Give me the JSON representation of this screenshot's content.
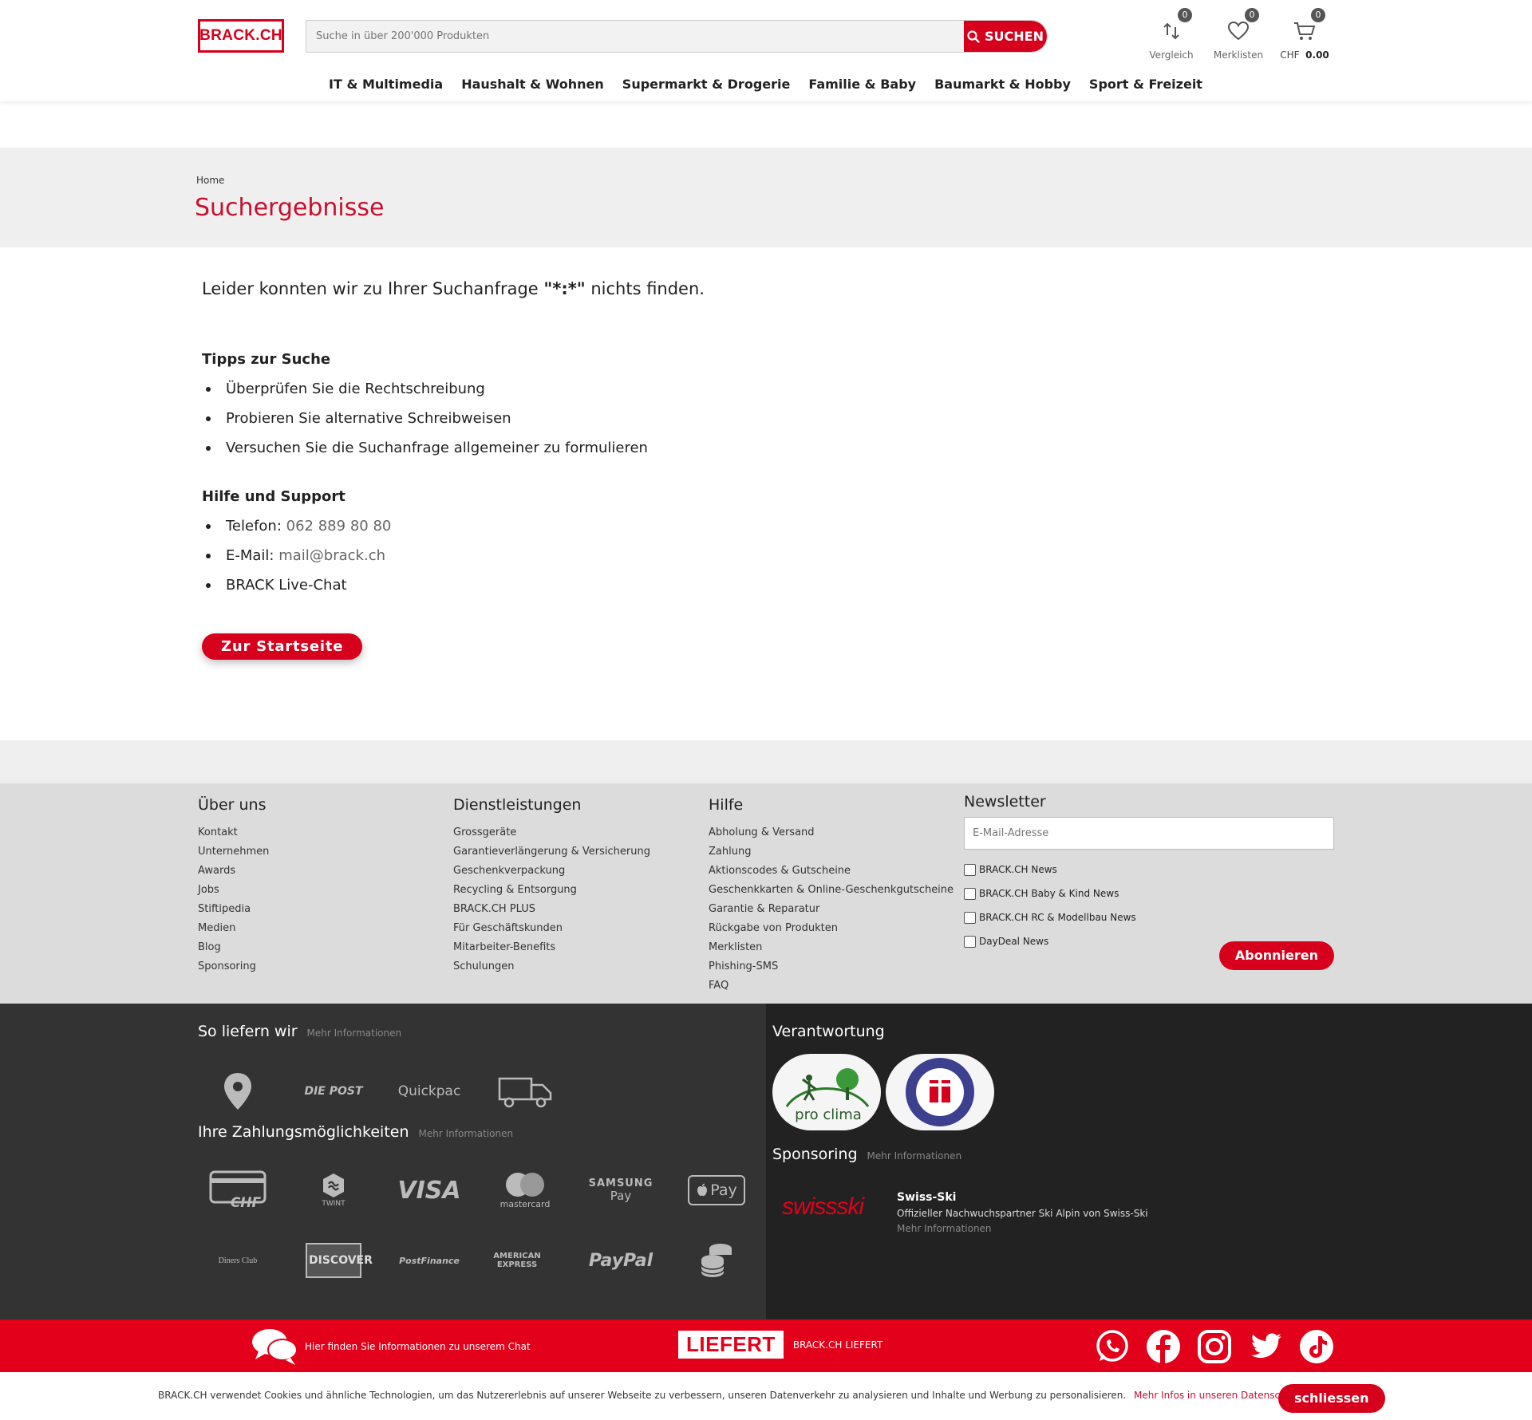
{
  "header": {
    "logo": "BRACK.CH",
    "search_placeholder": "Suche in über 200'000 Produkten",
    "search_button": "SUCHEN",
    "compare": {
      "label": "Vergleich",
      "count": "0"
    },
    "wishlist": {
      "label": "Merklisten",
      "count": "0"
    },
    "cart": {
      "currency": "CHF",
      "amount": "0.00",
      "count": "0"
    },
    "nav": [
      "IT & Multimedia",
      "Haushalt & Wohnen",
      "Supermarkt & Drogerie",
      "Familie & Baby",
      "Baumarkt & Hobby",
      "Sport & Freizeit"
    ]
  },
  "page": {
    "breadcrumb": "Home",
    "title": "Suchergebnisse",
    "no_results_prefix": "Leider konnten wir zu Ihrer Suchanfrage",
    "query": "\"*:*\"",
    "no_results_suffix": "nichts finden.",
    "tips_title": "Tipps zur Suche",
    "tips": [
      "Überprüfen Sie die Rechtschreibung",
      "Probieren Sie alternative Schreibweisen",
      "Versuchen Sie die Suchanfrage allgemeiner zu formulieren"
    ],
    "help_title": "Hilfe und Support",
    "phone_label": "Telefon:",
    "phone": "062 889 80 80",
    "email_label": "E-Mail:",
    "email": "mail@brack.ch",
    "livechat": "BRACK Live-Chat",
    "home_button": "Zur Startseite"
  },
  "footer": {
    "about": {
      "title": "Über uns",
      "links": [
        "Kontakt",
        "Unternehmen",
        "Awards",
        "Jobs",
        "Stiftipedia",
        "Medien",
        "Blog",
        "Sponsoring"
      ]
    },
    "services": {
      "title": "Dienstleistungen",
      "links": [
        "Grossgeräte",
        "Garantieverlängerung & Versicherung",
        "Geschenkverpackung",
        "Recycling & Entsorgung",
        "BRACK.CH PLUS",
        "Für Geschäftskunden",
        "Mitarbeiter-Benefits",
        "Schulungen"
      ]
    },
    "help": {
      "title": "Hilfe",
      "links": [
        "Abholung & Versand",
        "Zahlung",
        "Aktionscodes & Gutscheine",
        "Geschenkkarten & Online-Geschenkgutscheine",
        "Garantie & Reparatur",
        "Rückgabe von Produkten",
        "Merklisten",
        "Phishing-SMS",
        "FAQ"
      ]
    },
    "newsletter": {
      "title": "Newsletter",
      "email_placeholder": "E-Mail-Adresse",
      "options": [
        "BRACK.CH News",
        "BRACK.CH Baby & Kind News",
        "BRACK.CH RC & Modellbau News",
        "DayDeal News"
      ],
      "subscribe": "Abonnieren"
    },
    "delivery": {
      "title": "So liefern wir",
      "more": "Mehr Informationen",
      "logos": {
        "post": "DIE POST",
        "quickpac": "Quickpac"
      }
    },
    "payment": {
      "title": "Ihre Zahlungsmöglichkeiten",
      "more": "Mehr Informationen",
      "logos": {
        "chf": "CHF",
        "twint": "TWINT",
        "visa": "VISA",
        "mastercard": "mastercard",
        "samsung": "SAMSUNG",
        "samsung_pay": "Pay",
        "applepay": "Pay",
        "diners": "Diners Club",
        "discover": "DISCOVER",
        "postfinance": "PostFinance",
        "amex": "AMERICAN EXPRESS",
        "paypal": "PayPal"
      }
    },
    "responsibility": {
      "title": "Verantwortung",
      "proclima": "pro clima"
    },
    "sponsoring": {
      "title": "Sponsoring",
      "more": "Mehr Informationen",
      "name": "Swiss-Ski",
      "desc": "Offizieller Nachwuchspartner Ski Alpin von Swiss-Ski",
      "link": "Mehr Informationen",
      "logo_text": "swissski"
    }
  },
  "redbar": {
    "chat_info": "Hier finden Sie Informationen zu unserem Chat",
    "liefert_logo": "LIEFERT",
    "liefert_text": "BRACK.CH LIEFERT"
  },
  "cookie": {
    "text": "BRACK.CH verwendet Cookies und ähnliche Technologien, um das Nutzererlebnis auf unserer Webseite zu verbessern, unseren Datenverkehr zu analysieren und Inhalte und Werbung zu personalisieren.",
    "link": "Mehr Infos in unseren Datenschutzhinweisen",
    "button": "schliessen"
  },
  "colors": {
    "brand_red": "#d6001c",
    "title_red": "#c8102e",
    "dark_footer_left": "#333333",
    "dark_footer_right": "#222222"
  }
}
